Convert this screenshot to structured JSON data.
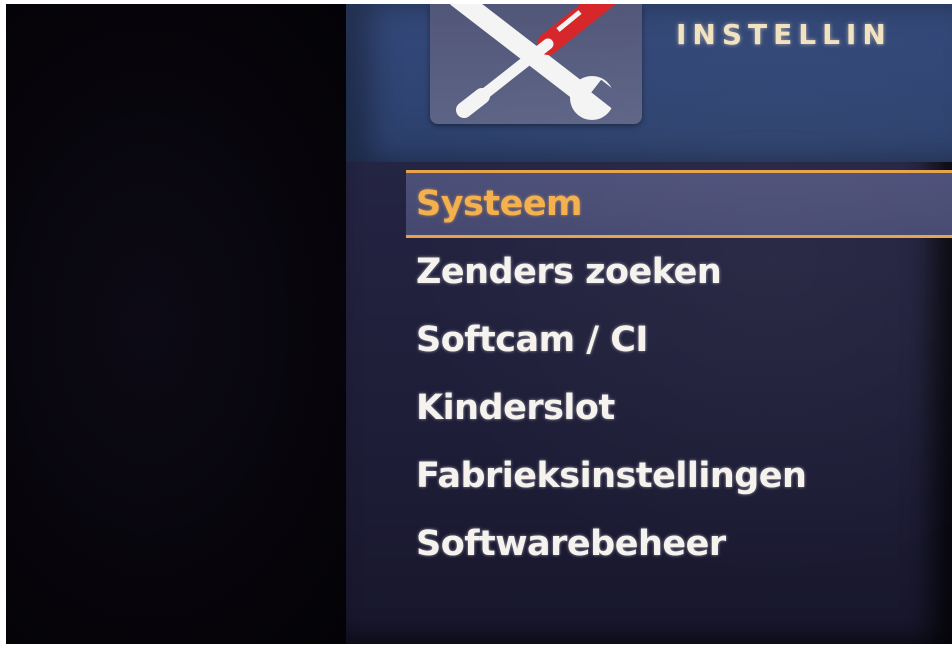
{
  "header": {
    "title": "INSTELLIN",
    "icon": "tools-icon"
  },
  "menu": {
    "items": [
      {
        "label": "Systeem",
        "selected": true
      },
      {
        "label": "Zenders zoeken",
        "selected": false
      },
      {
        "label": "Softcam / CI",
        "selected": false
      },
      {
        "label": "Kinderslot",
        "selected": false
      },
      {
        "label": "Fabrieksinstellingen",
        "selected": false
      },
      {
        "label": "Softwarebeheer",
        "selected": false
      }
    ]
  },
  "colors": {
    "screen_background": "#22223f",
    "header_background": "#2f4473",
    "selected_text": "#f4b04c",
    "selected_border": "#e7a24a",
    "menu_text": "#f6f3ef",
    "title_text": "#f1e2c0"
  }
}
